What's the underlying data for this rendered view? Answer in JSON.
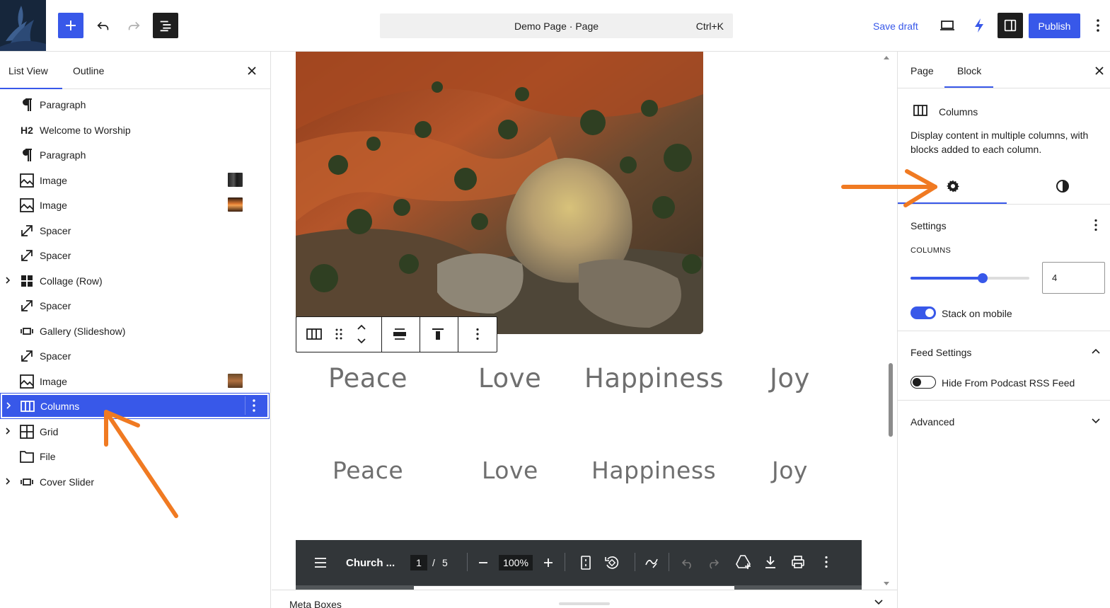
{
  "header": {
    "document_title": "Demo Page · Page",
    "shortcut": "Ctrl+K",
    "save_draft": "Save draft",
    "publish": "Publish"
  },
  "left_panel": {
    "tabs": [
      "List View",
      "Outline"
    ],
    "h2_marker": "H2",
    "items": [
      {
        "label": "Paragraph",
        "icon": "paragraph-icon"
      },
      {
        "label": "Welcome to Worship",
        "icon": "heading-icon"
      },
      {
        "label": "Paragraph",
        "icon": "paragraph-icon"
      },
      {
        "label": "Image",
        "icon": "image-icon"
      },
      {
        "label": "Image",
        "icon": "image-icon"
      },
      {
        "label": "Spacer",
        "icon": "spacer-icon"
      },
      {
        "label": "Spacer",
        "icon": "spacer-icon"
      },
      {
        "label": "Collage (Row)",
        "icon": "collage-icon"
      },
      {
        "label": "Spacer",
        "icon": "spacer-icon"
      },
      {
        "label": "Gallery (Slideshow)",
        "icon": "slideshow-icon"
      },
      {
        "label": "Spacer",
        "icon": "spacer-icon"
      },
      {
        "label": "Image",
        "icon": "image-icon"
      },
      {
        "label": "Columns",
        "icon": "columns-icon",
        "selected": true
      },
      {
        "label": "Grid",
        "icon": "grid-icon"
      },
      {
        "label": "File",
        "icon": "file-icon"
      },
      {
        "label": "Cover Slider",
        "icon": "slideshow-icon"
      }
    ]
  },
  "canvas": {
    "columns_row_1": [
      "Peace",
      "Love",
      "Happiness",
      "Joy"
    ],
    "columns_row_2": [
      "Peace",
      "Love",
      "Happiness",
      "Joy"
    ],
    "pdf_toolbar": {
      "title": "Church ...",
      "page_current": "1",
      "page_separator": "/",
      "page_total": "5",
      "zoom": "100%"
    },
    "meta_boxes": "Meta Boxes"
  },
  "right_panel": {
    "tabs": [
      "Page",
      "Block"
    ],
    "block_name": "Columns",
    "block_description": "Display content in multiple columns, with blocks added to each column.",
    "settings_title": "Settings",
    "columns_label": "COLUMNS",
    "columns_value": "4",
    "columns_slider_fraction": 0.6,
    "stack_on_mobile": "Stack on mobile",
    "stack_on_mobile_on": true,
    "feed_settings": "Feed Settings",
    "hide_from_podcast": "Hide From Podcast RSS Feed",
    "hide_from_podcast_on": false,
    "advanced": "Advanced"
  },
  "colors": {
    "accent": "#3858e9",
    "annotation_arrow": "#f07a22",
    "pdf_toolbar_bg": "#323639"
  }
}
